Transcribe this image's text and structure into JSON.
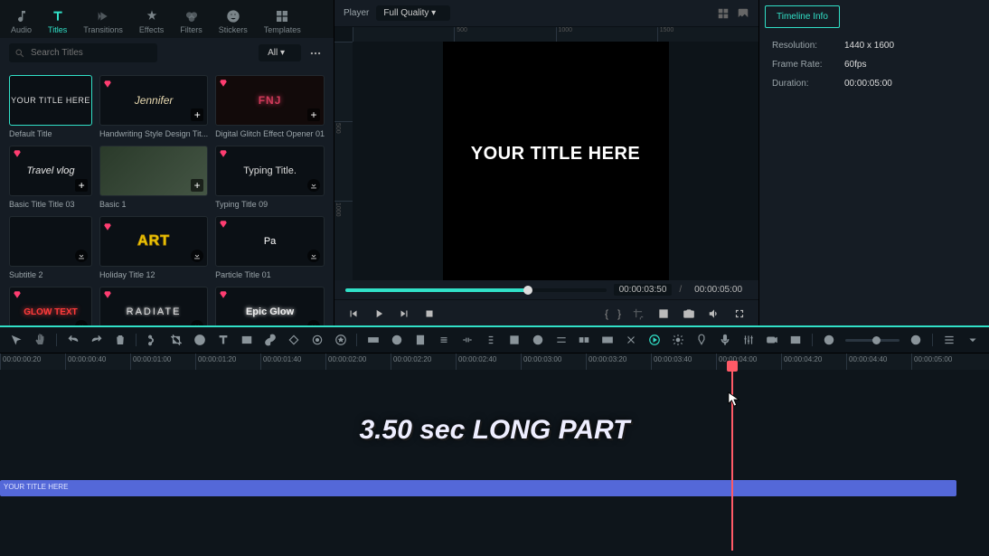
{
  "tabs": [
    {
      "id": "audio",
      "label": "Audio"
    },
    {
      "id": "titles",
      "label": "Titles"
    },
    {
      "id": "transitions",
      "label": "Transitions"
    },
    {
      "id": "effects",
      "label": "Effects"
    },
    {
      "id": "filters",
      "label": "Filters"
    },
    {
      "id": "stickers",
      "label": "Stickers"
    },
    {
      "id": "templates",
      "label": "Templates"
    }
  ],
  "search": {
    "placeholder": "Search Titles"
  },
  "filter_dd": "All",
  "tiles": [
    {
      "name": "Default Title",
      "preview": "YOUR TITLE HERE",
      "cls": "thumb-default",
      "sel": true,
      "gem": false,
      "btn": "none"
    },
    {
      "name": "Handwriting Style Design Tit...",
      "preview": "Jennifer",
      "cls": "thumb-jennifer",
      "sel": false,
      "gem": true,
      "btn": "plus"
    },
    {
      "name": "Digital Glitch Effect Opener 01",
      "preview": "FNJ",
      "cls": "thumb-glitch",
      "sel": false,
      "gem": true,
      "btn": "plus"
    },
    {
      "name": "Basic Title Title 03",
      "preview": "Travel vlog",
      "cls": "thumb-travel",
      "sel": false,
      "gem": true,
      "btn": "plus"
    },
    {
      "name": "Basic 1",
      "preview": "",
      "cls": "thumb-basic1",
      "sel": false,
      "gem": false,
      "btn": "plus"
    },
    {
      "name": "Typing Title 09",
      "preview": "Typing Title.",
      "cls": "thumb-typing",
      "sel": false,
      "gem": true,
      "btn": "dl"
    },
    {
      "name": "Subtitle 2",
      "preview": "",
      "cls": "",
      "sel": false,
      "gem": false,
      "btn": "dl"
    },
    {
      "name": "Holiday Title 12",
      "preview": "ART",
      "cls": "thumb-art",
      "sel": false,
      "gem": true,
      "btn": "dl"
    },
    {
      "name": "Particle Title 01",
      "preview": "Pa",
      "cls": "thumb-particle",
      "sel": false,
      "gem": true,
      "btn": "dl"
    },
    {
      "name": "",
      "preview": "GLOW TEXT",
      "cls": "thumb-glow",
      "sel": false,
      "gem": true,
      "btn": "dl"
    },
    {
      "name": "",
      "preview": "RADIATE",
      "cls": "thumb-radiate",
      "sel": false,
      "gem": true,
      "btn": "dl"
    },
    {
      "name": "",
      "preview": "Epic Glow",
      "cls": "thumb-epic",
      "sel": false,
      "gem": true,
      "btn": "dl"
    }
  ],
  "player": {
    "label": "Player",
    "quality": "Full Quality",
    "canvas_text": "YOUR TITLE HERE",
    "time_current": "00:00:03:50",
    "time_total": "00:00:05:00",
    "ruler_h": [
      "",
      "500",
      "1000",
      "1500"
    ],
    "ruler_v": [
      "",
      "500",
      "1000"
    ]
  },
  "info": {
    "tab": "Timeline Info",
    "rows": [
      {
        "k": "Resolution:",
        "v": "1440 x 1600"
      },
      {
        "k": "Frame Rate:",
        "v": "60fps"
      },
      {
        "k": "Duration:",
        "v": "00:00:05:00"
      }
    ]
  },
  "timeline": {
    "annotation": "3.50 sec LONG PART",
    "clip_label": "YOUR TITLE HERE",
    "ticks": [
      "00:00:00:20",
      "00:00:00:40",
      "00:00:01:00",
      "00:00:01:20",
      "00:00:01:40",
      "00:00:02:00",
      "00:00:02:20",
      "00:00:02:40",
      "00:00:03:00",
      "00:00:03:20",
      "00:00:03:40",
      "00:00:04:00",
      "00:00:04:20",
      "00:00:04:40",
      "00:00:05:00"
    ]
  }
}
